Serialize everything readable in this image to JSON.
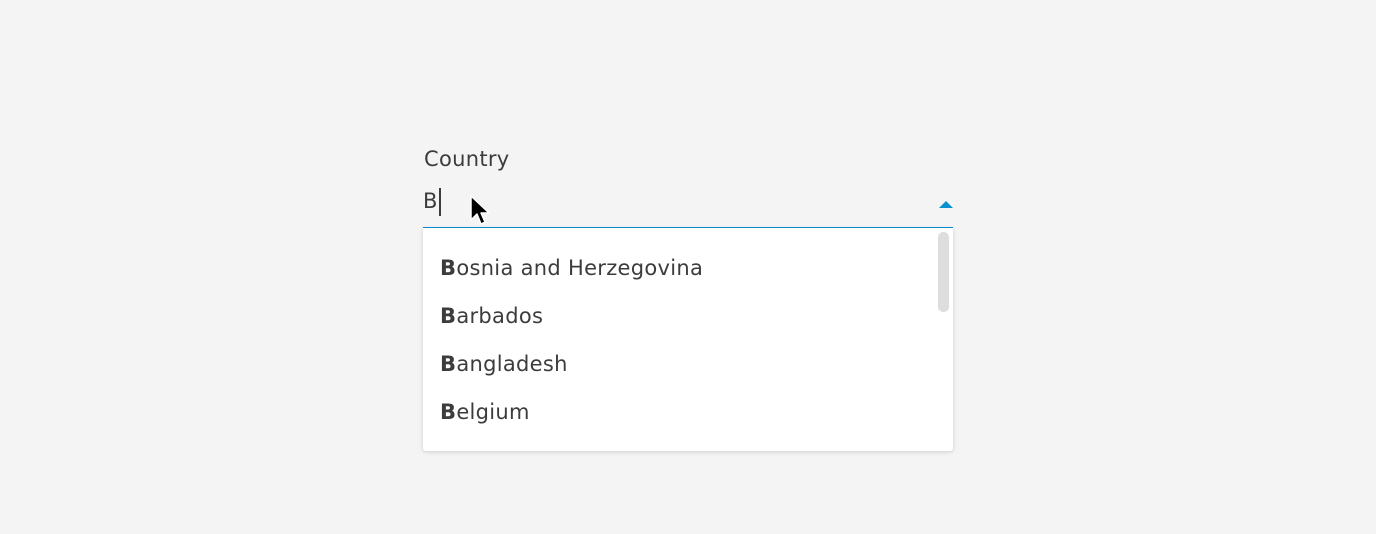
{
  "field": {
    "label": "Country",
    "value": "B"
  },
  "dropdown": {
    "options": [
      {
        "match": "B",
        "rest": "osnia and Herzegovina"
      },
      {
        "match": "B",
        "rest": "arbados"
      },
      {
        "match": "B",
        "rest": "angladesh"
      },
      {
        "match": "B",
        "rest": "elgium"
      }
    ]
  },
  "icons": {
    "dropdown_toggle": "arrow-up-icon",
    "pointer": "mouse-cursor-icon"
  },
  "colors": {
    "accent": "#0a91cf",
    "background": "#f4f4f4",
    "text": "#3c3c3c"
  }
}
